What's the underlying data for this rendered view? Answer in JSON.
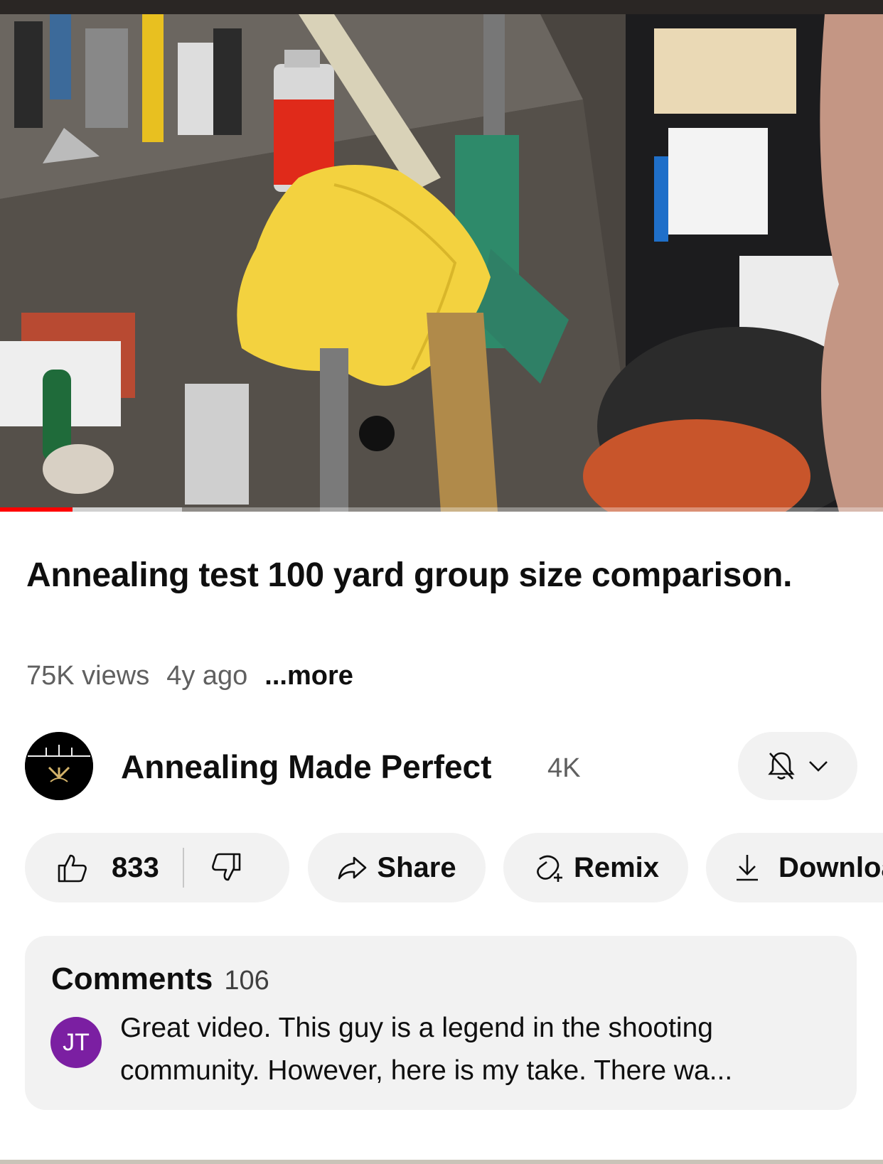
{
  "video": {
    "progress_fraction": 0.082,
    "buffer_fraction": 0.206
  },
  "title": "Annealing test 100 yard group size comparison.",
  "meta": {
    "views": "75K views",
    "age": "4y ago",
    "more": "...more"
  },
  "channel": {
    "name": "Annealing Made Perfect",
    "subscribers": "4K",
    "logo_text": "Annealing Made Perfect"
  },
  "actions": {
    "likes": "833",
    "share": "Share",
    "remix": "Remix",
    "download": "Download"
  },
  "comments": {
    "heading": "Comments",
    "count": "106",
    "top_comment": {
      "author_initials": "JT",
      "text": "Great video. This guy is a legend in the shooting community. However, here is my take. There wa..."
    }
  },
  "colors": {
    "progress": "#ff0000",
    "pill_bg": "#f2f2f2",
    "avatar_jt": "#7b1fa2",
    "meta_text": "#606060"
  }
}
